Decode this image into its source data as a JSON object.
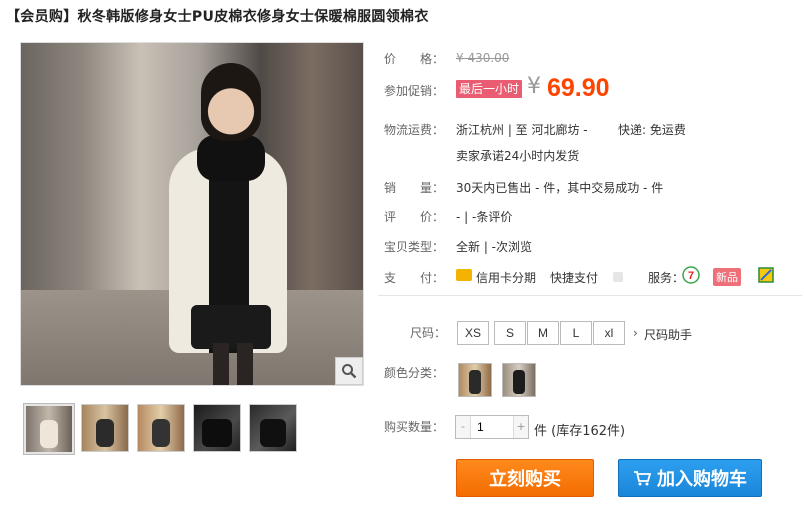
{
  "product": {
    "title": "【会员购】秋冬韩版修身女士PU皮棉衣修身女士保暖棉服圆领棉衣"
  },
  "price": {
    "label": "价　　格：",
    "original": "¥ 430.00"
  },
  "promo": {
    "label": "参加促销：",
    "tag": "最后一小时",
    "currency": "¥",
    "price": "69.90"
  },
  "shipping": {
    "label": "物流运费：",
    "route": "浙江杭州 | 至  河北廊坊 -",
    "fee": "快递: 免运费",
    "promise": "卖家承诺24小时内发货"
  },
  "sales": {
    "label": "销　　量：",
    "text": "30天内已售出 - 件，其中交易成功 - 件"
  },
  "reviews": {
    "label": "评　　价：",
    "text": "-  |  -条评价"
  },
  "item_type": {
    "label": "宝贝类型：",
    "text": "全新  |  -次浏览"
  },
  "payment": {
    "label": "支　　付：",
    "installment": "信用卡分期",
    "quick_pay": "快捷支付",
    "service_label": "服务：",
    "new_badge": "新品"
  },
  "size": {
    "label": "尺码：",
    "options": [
      "XS",
      "S",
      "M",
      "L",
      "xl"
    ],
    "helper": "尺码助手"
  },
  "color": {
    "label": "颜色分类："
  },
  "quantity": {
    "label": "购买数量：",
    "value": "1",
    "unit": "件 (库存162件)",
    "minus": "-",
    "plus": "+"
  },
  "actions": {
    "buy_now": "立刻购买",
    "add_cart": "加入购物车"
  },
  "colors": {
    "accent": "#ff4400",
    "promo_tag": "#e95c71",
    "buy_now": "#f46c00",
    "add_cart": "#1b86d8"
  }
}
